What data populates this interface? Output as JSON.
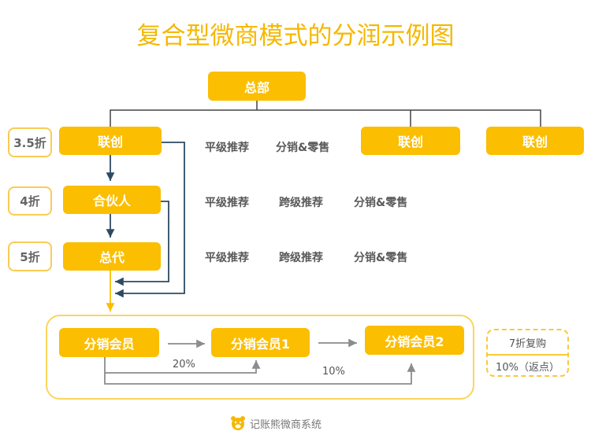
{
  "title": "复合型微商模式的分润示例图",
  "hq": "总部",
  "levels": [
    {
      "node": "联创",
      "discount": "3.5折",
      "relations": [
        "平级推荐",
        "分销&零售"
      ]
    },
    {
      "node": "合伙人",
      "discount": "4折",
      "relations": [
        "平级推荐",
        "跨级推荐",
        "分销&零售"
      ]
    },
    {
      "node": "总代",
      "discount": "5折",
      "relations": [
        "平级推荐",
        "跨级推荐",
        "分销&零售"
      ]
    }
  ],
  "peers": [
    "联创",
    "联创"
  ],
  "members": [
    "分销会员",
    "分销会员1",
    "分销会员2"
  ],
  "commissions": [
    "20%",
    "10%"
  ],
  "member_terms": {
    "repurchase": "7折复购",
    "rebate": "10%（返点）"
  },
  "footer": {
    "brand": "记账熊微商系统",
    "icon": "bear-icon"
  },
  "colors": {
    "accent": "#fbbe00",
    "title": "#f5b800",
    "arrow_dark": "#2e4a62",
    "arrow_gray": "#8c8c8c"
  }
}
